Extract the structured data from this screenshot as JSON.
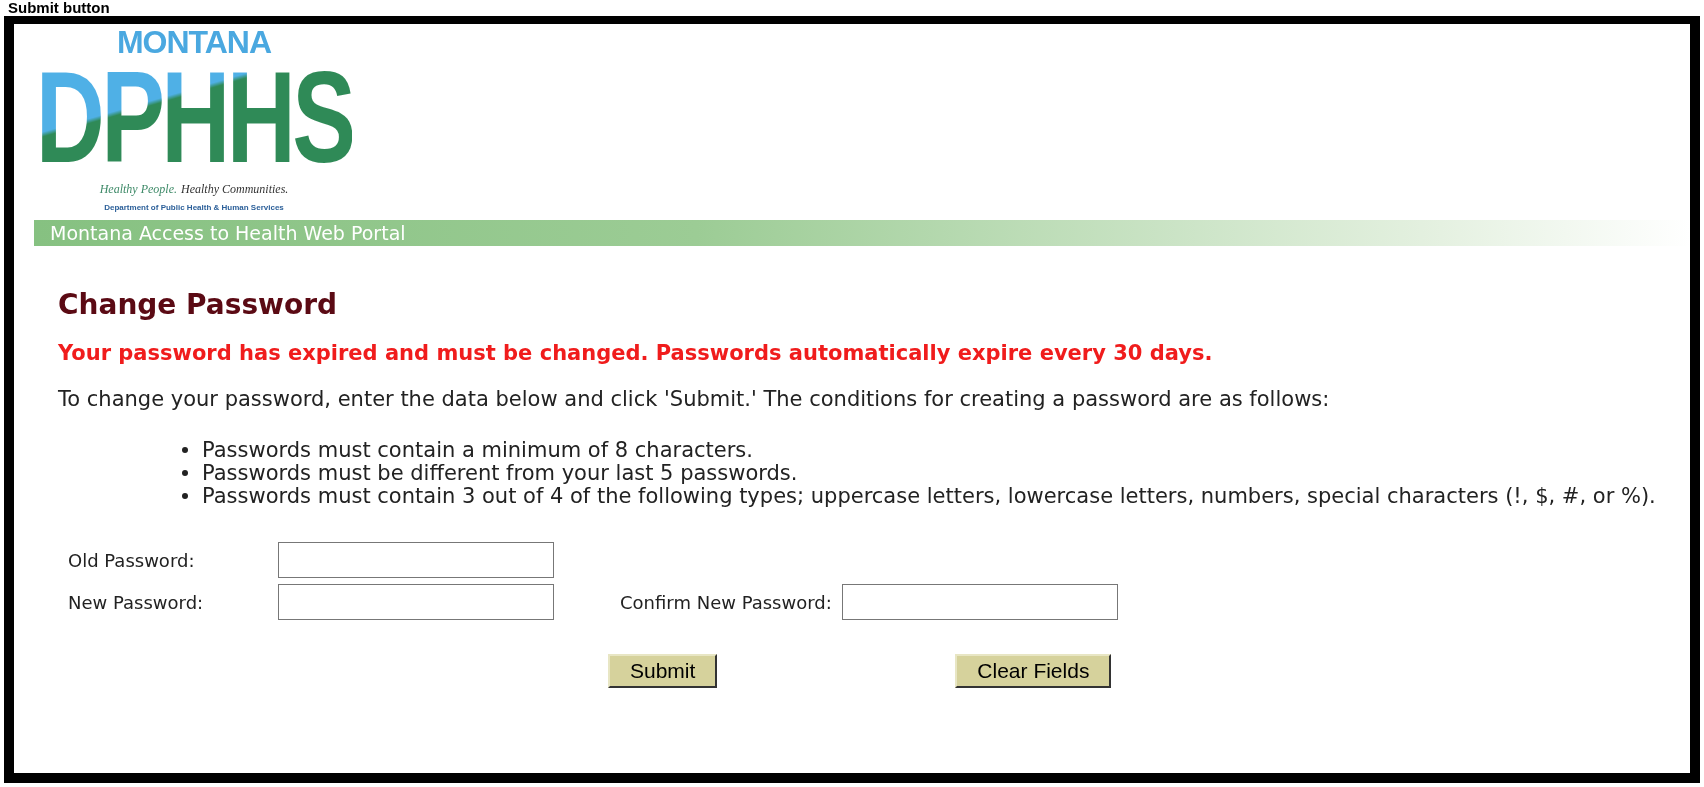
{
  "caption": "Submit button",
  "logo": {
    "state": "MONTANA",
    "letters": "DPHHS",
    "tagline_1": "Healthy People.",
    "tagline_2": "Healthy Communities.",
    "department": "Department of Public Health & Human Services"
  },
  "banner": {
    "title": "Montana Access to Health Web Portal"
  },
  "heading": "Change Password",
  "alert": "Your password has expired and must be changed. Passwords automatically expire every 30 days.",
  "intro": "To change your password, enter the data below and click 'Submit.' The conditions for creating a password are as follows:",
  "rules": [
    "Passwords must contain a minimum of 8 characters.",
    "Passwords must be different from your last 5 passwords.",
    "Passwords must contain 3 out of 4 of the following types; uppercase letters, lowercase letters, numbers, special characters (!, $, #, or %)."
  ],
  "fields": {
    "old": {
      "label": "Old Password:"
    },
    "new": {
      "label": "New Password:"
    },
    "confirm": {
      "label": "Confirm New Password:"
    }
  },
  "buttons": [
    "Submit",
    "Clear Fields"
  ]
}
